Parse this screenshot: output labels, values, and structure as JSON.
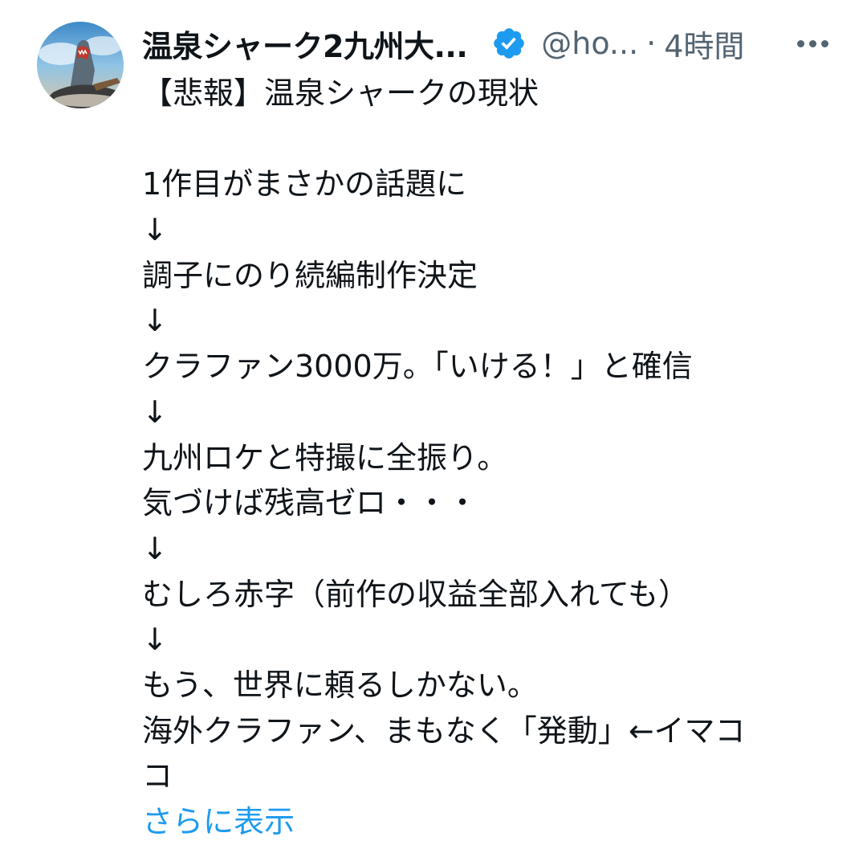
{
  "tweet": {
    "display_name": "温泉シャーク2九州大...",
    "handle": "@ho...",
    "separator": "·",
    "time": "4時間",
    "lines": [
      "【悲報】温泉シャークの現状",
      "",
      "1作目がまさかの話題に",
      "↓",
      "調子にのり続編制作決定",
      "↓",
      "クラファン3000万。「いける！」と確信",
      "↓",
      "九州ロケと特撮に全振り。",
      "気づけば残高ゼロ・・・",
      "↓",
      "むしろ赤字（前作の収益全部入れても）",
      "↓",
      "もう、世界に頼るしかない。",
      "海外クラファン、まもなく「発動」←イマコ",
      "コ"
    ],
    "show_more": "さらに表示"
  },
  "icons": {
    "avatar": "shark-avatar-image",
    "verified": "verified-badge-icon",
    "more": "more-options-icon"
  },
  "colors": {
    "text": "#0f1419",
    "secondary": "#536471",
    "accent": "#1d9bf0"
  }
}
